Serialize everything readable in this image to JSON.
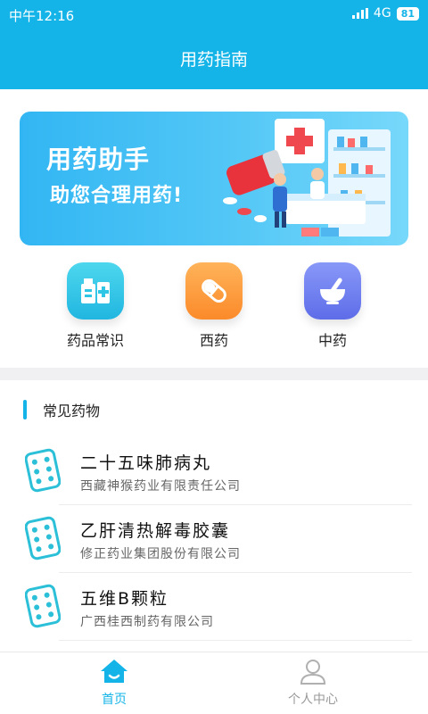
{
  "status": {
    "time": "中午12:16",
    "network": "4G",
    "battery": "81"
  },
  "appbar": {
    "title": "用药指南"
  },
  "banner": {
    "title": "用药助手",
    "subtitle": "助您合理用药!"
  },
  "categories": [
    {
      "label": "药品常识",
      "icon": "medicine-bottle-icon",
      "color": "#2fc6e6"
    },
    {
      "label": "西药",
      "icon": "pill-capsule-icon",
      "color": "#fb9a3a"
    },
    {
      "label": "中药",
      "icon": "mortar-pestle-icon",
      "color": "#6f7ff0"
    }
  ],
  "section": {
    "title": "常见药物"
  },
  "drugs": [
    {
      "name": "二十五味肺病丸",
      "company": "西藏神猴药业有限责任公司"
    },
    {
      "name": "乙肝清热解毒胶囊",
      "company": "修正药业集团股份有限公司"
    },
    {
      "name": "五维B颗粒",
      "company": "广西桂西制药有限公司"
    }
  ],
  "tabs": [
    {
      "label": "首页",
      "icon": "home-icon",
      "active": true
    },
    {
      "label": "个人中心",
      "icon": "person-icon",
      "active": false
    }
  ],
  "colors": {
    "primary": "#14b4e8",
    "tab_active": "#14b4e8",
    "tab_inactive": "#999999"
  }
}
